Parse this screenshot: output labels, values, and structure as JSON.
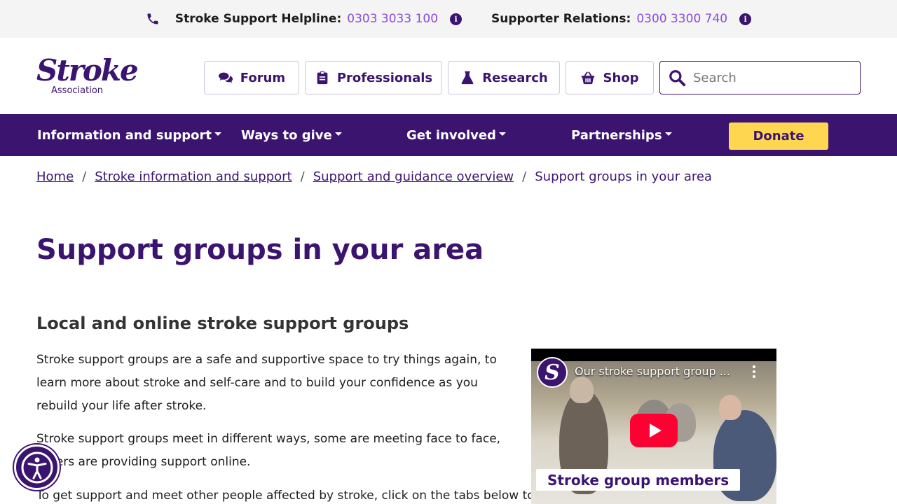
{
  "topbar": {
    "helpline_label": "Stroke Support Helpline:",
    "helpline_number": "0303 3033 100",
    "relations_label": "Supporter Relations:",
    "relations_number": "0300 3300 740",
    "info_glyph": "i"
  },
  "logo": {
    "word": "Stroke",
    "sub": "Association"
  },
  "header_buttons": {
    "forum": "Forum",
    "professionals": "Professionals",
    "research": "Research",
    "shop": "Shop"
  },
  "search": {
    "placeholder": "Search"
  },
  "nav": {
    "items": [
      "Information and support",
      "Ways to give",
      "Get involved",
      "Partnerships"
    ],
    "donate": "Donate"
  },
  "breadcrumb": {
    "links": [
      "Home",
      "Stroke information and support",
      "Support and guidance overview"
    ],
    "current": "Support groups in your area",
    "separator": "/"
  },
  "page": {
    "title": "Support groups in your area",
    "subtitle": "Local and online stroke support groups",
    "paragraphs": [
      "Stroke support groups are a safe and supportive space to try things again, to learn more about stroke and self-care and to build your confidence as you rebuild your life after stroke.",
      "Stroke support groups meet in different ways, some are meeting face to face, others are providing support online.",
      "To get support and meet other people affected by stroke, click on the tabs below to see"
    ]
  },
  "video": {
    "channel_letter": "S",
    "title": "Our stroke support group ...",
    "caption": "Stroke group members"
  },
  "colors": {
    "brand_purple": "#3b1470",
    "link_purple": "#8b4bd9",
    "donate_yellow": "#ffd64f",
    "play_red": "#ff0033"
  },
  "icons": [
    "phone-icon",
    "info-icon",
    "comments-icon",
    "clipboard-icon",
    "flask-icon",
    "basket-icon",
    "search-icon",
    "accessibility-icon"
  ]
}
